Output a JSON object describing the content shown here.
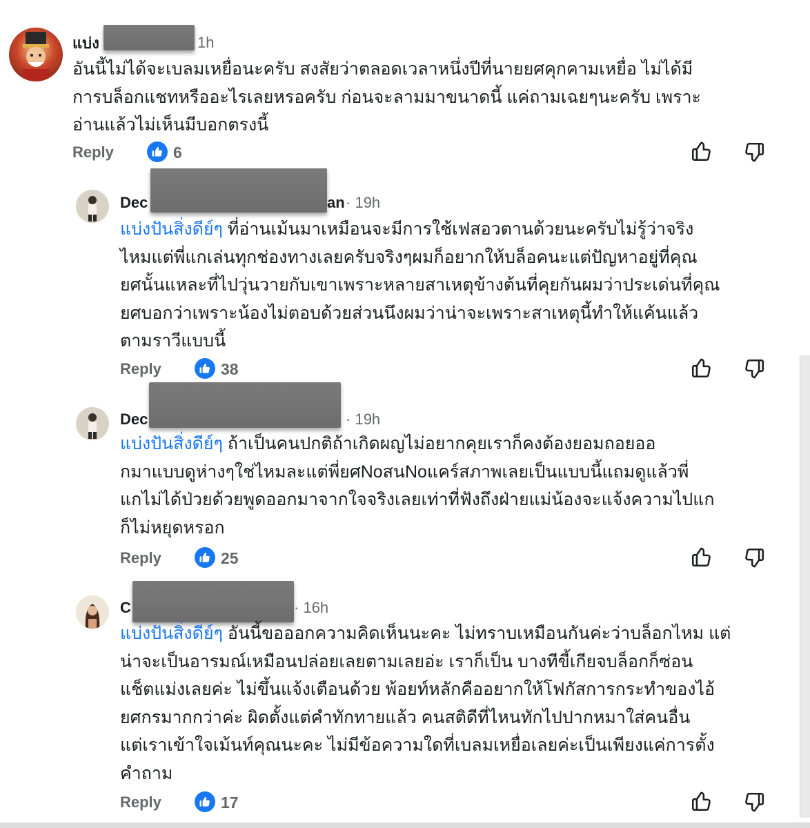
{
  "colors": {
    "accent": "#1877f2",
    "meta": "#65676b",
    "text": "#1c1e21"
  },
  "comments": [
    {
      "name_visible": "แบ่ง",
      "time": "1h",
      "mention": "",
      "lines": [
        "อันนี้ไม่ได้จะเบลมเหยื่อนะครับ สงสัยว่าตลอดเวลาหนึ่งปีที่นายยศคุกคามเหยื่อ ไม่ได้มี",
        "การบล็อกแชทหรืออะไรเลยหรอครับ ก่อนจะลามมาขนาดนี้ แค่ถามเฉยๆนะครับ เพราะ",
        "อ่านแล้วไม่เห็นมีบอกตรงนี้"
      ],
      "reply_label": "Reply",
      "likes": "6"
    },
    {
      "name_visible": "Dec",
      "name_tail": "an",
      "time": "19h",
      "mention": "แบ่งปันสิ่งดีย์ๆ",
      "lines": [
        " ที่อ่านเม้นมาเหมือนจะมีการใช้เฟสอวตานด้วยนะครับไม่รู้ว่าจริง",
        "ไหมแต่พี่แกเล่นทุกช่องทางเลยครับจริงๆผมก็อยากให้บล็อคนะแต่ปัญหาอยู่ที่คุณ",
        "ยศนั้นแหละที่ไปวุ่นวายกับเขาเพราะหลายสาเหตุข้างต้นที่คุยกันผมว่าประเด่นที่คุณ",
        "ยศบอกว่าเพราะน้องไม่ตอบด้วยส่วนนึงผมว่าน่าจะเพราะสาเหตุนี้ทำให้แค้นแล้ว",
        "ตามราวีแบบนี้"
      ],
      "reply_label": "Reply",
      "likes": "38"
    },
    {
      "name_visible": "Dec",
      "time": "19h",
      "mention": "แบ่งปันสิ่งดีย์ๆ",
      "lines": [
        " ถ้าเป็นคนปกติถ้าเกิดผญไม่อยากคุยเราก็คงต้องยอมถอยออ",
        "กมาแบบดูห่างๆใช่ไหมละแต่พี่ยศNoสนNoแคร์สภาพเลยเป็นแบบนี้แถมดูแล้วพี่",
        "แกไม่ได้ป่วยด้วยพูดออกมาจากใจจริงเลยเท่าที่ฟังถึงฝ่ายแม่น้องจะแจ้งความไปแก",
        "ก็ไม่หยุดหรอก"
      ],
      "reply_label": "Reply",
      "likes": "25"
    },
    {
      "name_visible": "C",
      "time": "16h",
      "mention": "แบ่งปันสิ่งดีย์ๆ",
      "lines": [
        " อันนี้ขอออกความคิดเห็นนะคะ ไม่ทราบเหมือนกันค่ะว่าบล็อกไหม แต่",
        "น่าจะเป็นอารมณ์เหมือนปล่อยเลยตามเลยอ่ะ เราก็เป็น บางทีขี้เกียจบล็อกก็ซ่อน",
        "แช็ตแม่งเลยค่ะ ไม่ขึ้นแจ้งเตือนด้วย พ้อยท์หลักคืออยากให้โฟกัสการกระทำของไอ้",
        "ยศกรมากกว่าค่ะ ผิดตั้งแต่คำทักทายแล้ว คนสติดีที่ไหนทักไปปากหมาใส่คนอื่น",
        "แต่เราเข้าใจเม้นท์คุณนะคะ ไม่มีข้อความใดที่เบลมเหยื่อเลยค่ะเป็นเพียงแค่การตั้ง",
        "คำถาม"
      ],
      "reply_label": "Reply",
      "likes": "17"
    }
  ],
  "icons": {
    "like_badge": "thumbs-up-badge-icon",
    "upvote": "thumbs-up-outline-icon",
    "downvote": "thumbs-down-outline-icon"
  }
}
